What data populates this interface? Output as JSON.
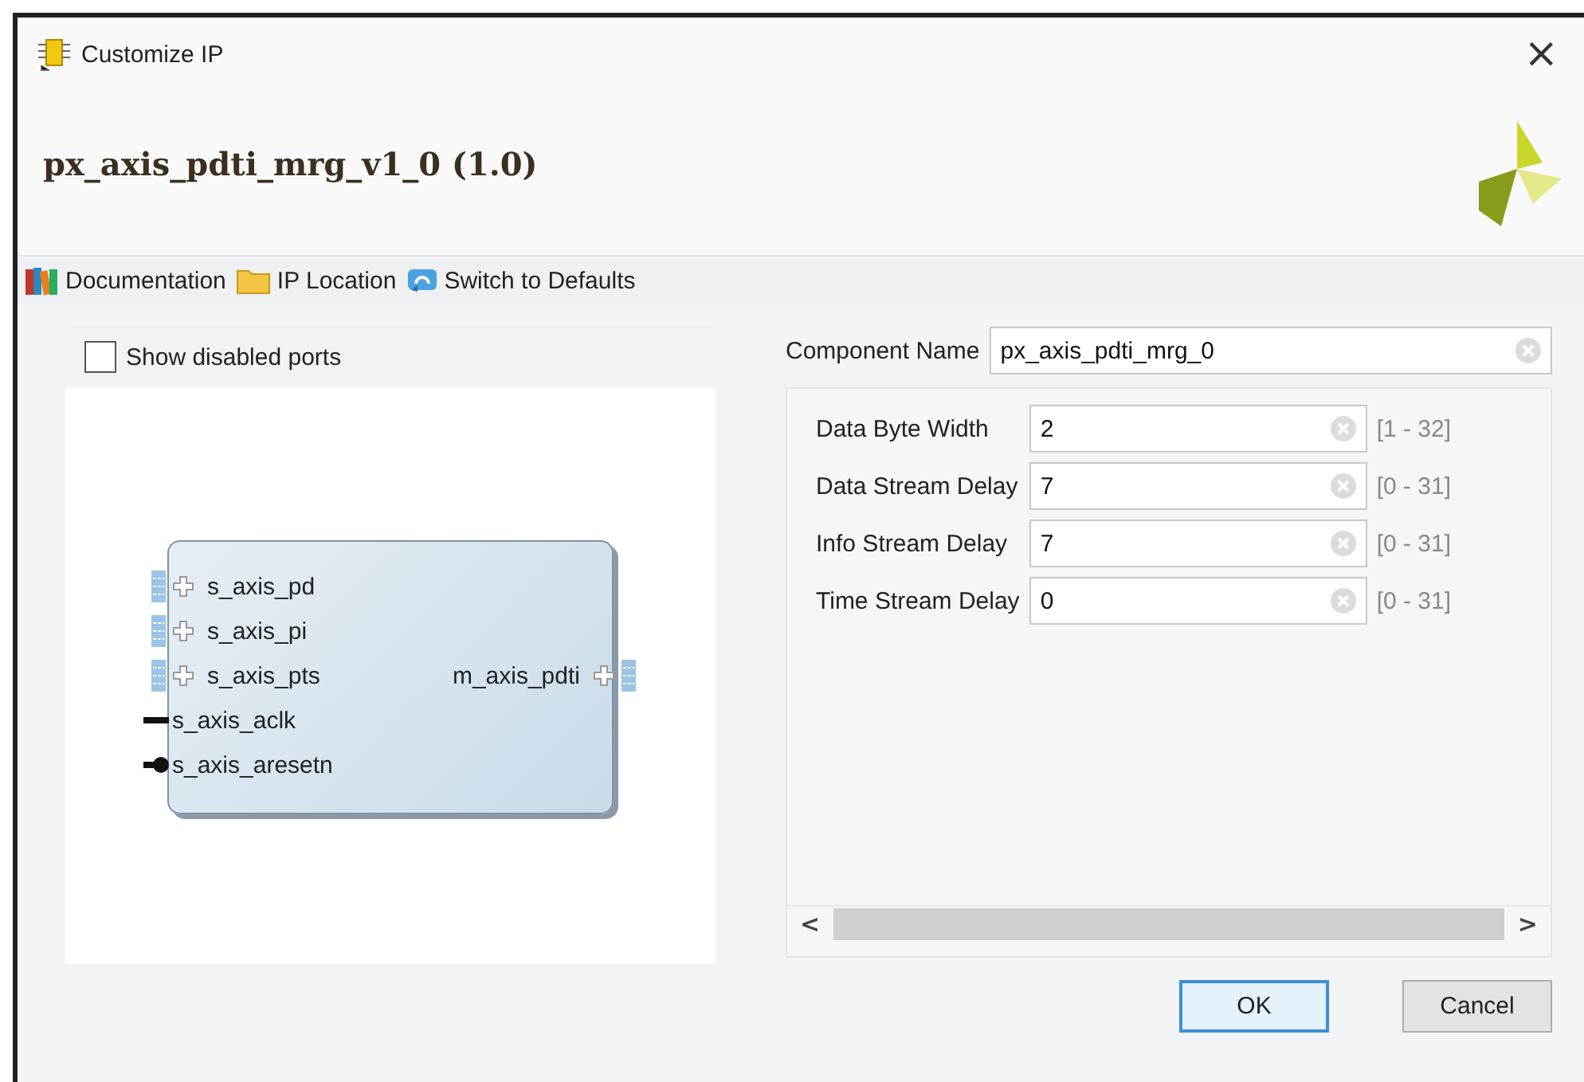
{
  "window": {
    "title": "Customize IP",
    "close": "×"
  },
  "header": {
    "title": "px_axis_pdti_mrg_v1_0 (1.0)"
  },
  "toolbar": [
    {
      "label": "Documentation",
      "kind": "books"
    },
    {
      "label": "IP Location",
      "kind": "folder"
    },
    {
      "label": "Switch to Defaults",
      "kind": "refresh"
    }
  ],
  "diagram": {
    "show_disabled_ports": {
      "label": "Show disabled ports",
      "checked": false
    },
    "left_ports": [
      {
        "name": "s_axis_pd",
        "kind": "bus"
      },
      {
        "name": "s_axis_pi",
        "kind": "bus"
      },
      {
        "name": "s_axis_pts",
        "kind": "bus"
      },
      {
        "name": "s_axis_aclk",
        "kind": "clock"
      },
      {
        "name": "s_axis_aresetn",
        "kind": "reset"
      }
    ],
    "right_ports": [
      {
        "name": "m_axis_pdti",
        "kind": "bus"
      }
    ]
  },
  "component_name": {
    "label": "Component Name",
    "value": "px_axis_pdti_mrg_0"
  },
  "params": [
    {
      "label": "Data Byte Width",
      "value": "2",
      "range": "[1 - 32]"
    },
    {
      "label": "Data Stream Delay",
      "value": "7",
      "range": "[0 - 31]"
    },
    {
      "label": "Info Stream Delay",
      "value": "7",
      "range": "[0 - 31]"
    },
    {
      "label": "Time Stream Delay",
      "value": "0",
      "range": "[0 - 31]"
    }
  ],
  "scrollbar": {
    "left": "<",
    "right": ">"
  },
  "buttons": [
    {
      "label": "OK",
      "default": true
    },
    {
      "label": "Cancel",
      "default": false
    }
  ]
}
